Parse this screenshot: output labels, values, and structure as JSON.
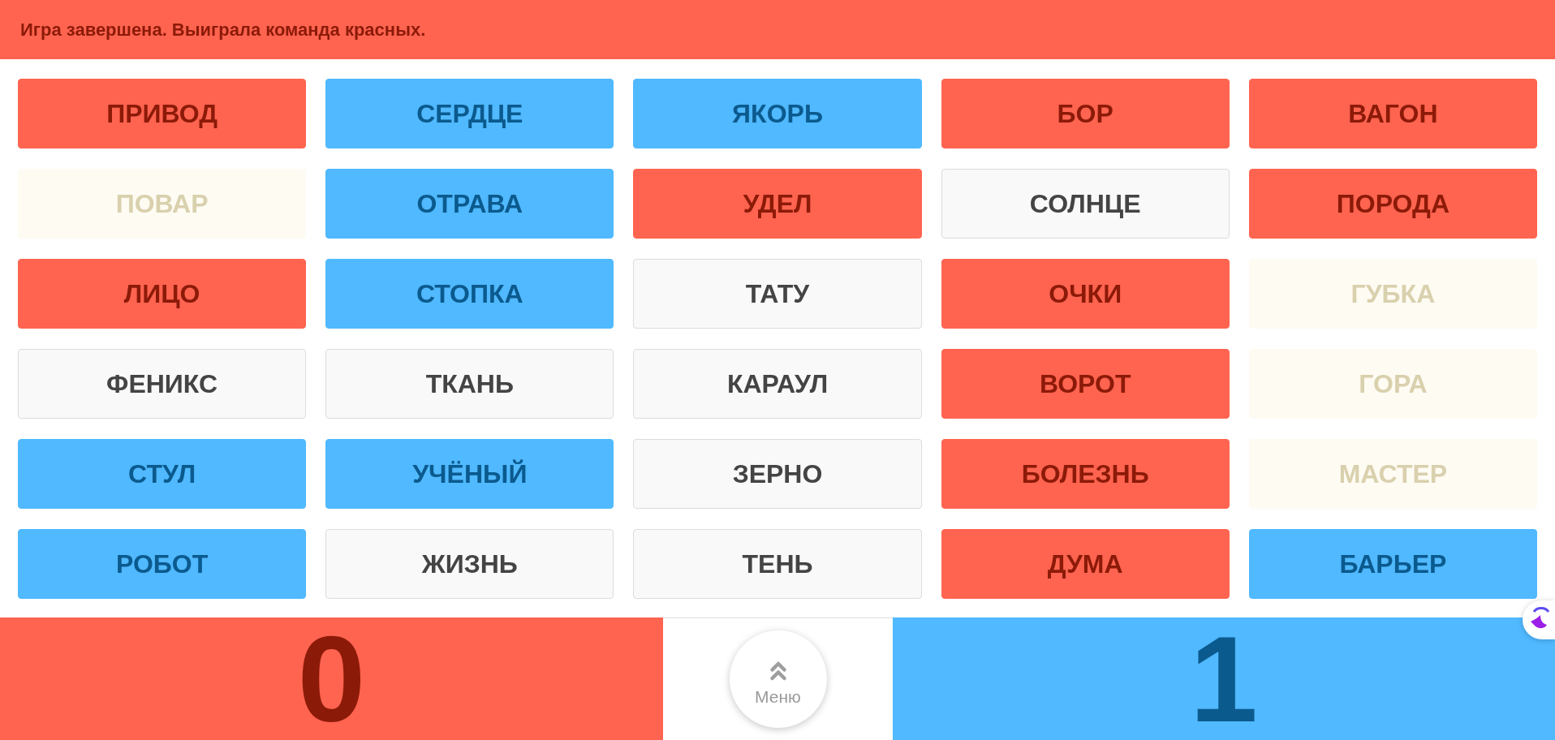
{
  "status": {
    "kind": "red",
    "text": "Игра завершена. Выиграла команда красных."
  },
  "board": {
    "cards": [
      {
        "word": "ПРИВОД",
        "kind": "red"
      },
      {
        "word": "СЕРДЦЕ",
        "kind": "blue"
      },
      {
        "word": "ЯКОРЬ",
        "kind": "blue"
      },
      {
        "word": "БОР",
        "kind": "red"
      },
      {
        "word": "ВАГОН",
        "kind": "red"
      },
      {
        "word": "ПОВАР",
        "kind": "faded"
      },
      {
        "word": "ОТРАВА",
        "kind": "blue"
      },
      {
        "word": "УДЕЛ",
        "kind": "red"
      },
      {
        "word": "СОЛНЦЕ",
        "kind": "neutral"
      },
      {
        "word": "ПОРОДА",
        "kind": "red"
      },
      {
        "word": "ЛИЦО",
        "kind": "red"
      },
      {
        "word": "СТОПКА",
        "kind": "blue"
      },
      {
        "word": "ТАТУ",
        "kind": "neutral"
      },
      {
        "word": "ОЧКИ",
        "kind": "red"
      },
      {
        "word": "ГУБКА",
        "kind": "faded"
      },
      {
        "word": "ФЕНИКС",
        "kind": "neutral"
      },
      {
        "word": "ТКАНЬ",
        "kind": "neutral"
      },
      {
        "word": "КАРАУЛ",
        "kind": "neutral"
      },
      {
        "word": "ВОРОТ",
        "kind": "red"
      },
      {
        "word": "ГОРА",
        "kind": "faded"
      },
      {
        "word": "СТУЛ",
        "kind": "blue"
      },
      {
        "word": "УЧЁНЫЙ",
        "kind": "blue"
      },
      {
        "word": "ЗЕРНО",
        "kind": "neutral"
      },
      {
        "word": "БОЛЕЗНЬ",
        "kind": "red"
      },
      {
        "word": "МАСТЕР",
        "kind": "faded"
      },
      {
        "word": "РОБОТ",
        "kind": "blue"
      },
      {
        "word": "ЖИЗНЬ",
        "kind": "neutral"
      },
      {
        "word": "ТЕНЬ",
        "kind": "neutral"
      },
      {
        "word": "ДУМА",
        "kind": "red"
      },
      {
        "word": "БАРЬЕР",
        "kind": "blue"
      }
    ]
  },
  "footer": {
    "scores": [
      {
        "kind": "red",
        "value": "0"
      },
      {
        "kind": "blue",
        "value": "1"
      }
    ],
    "menu_button": {
      "label": "Меню"
    }
  }
}
